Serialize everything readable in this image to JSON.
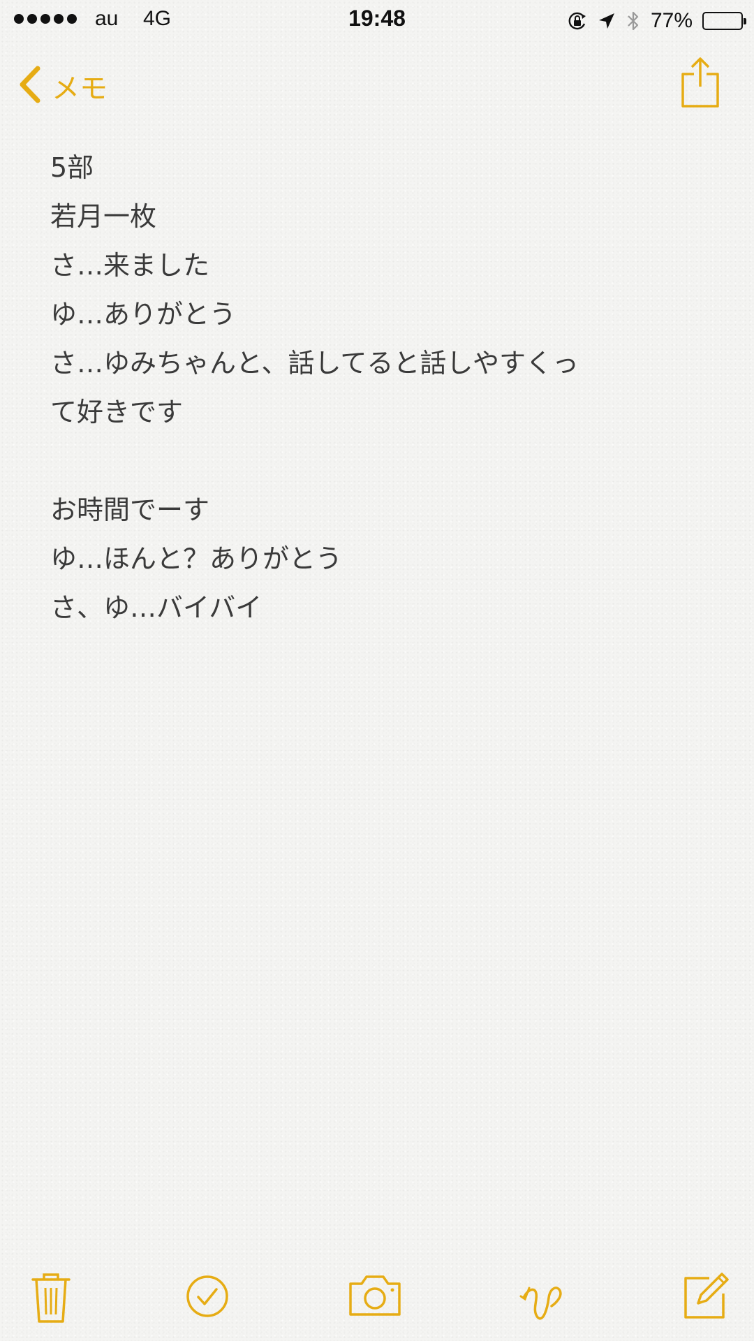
{
  "status_bar": {
    "carrier": "au",
    "network": "4G",
    "time": "19:48",
    "battery_percent": "77%",
    "battery_level": 0.77,
    "signal_bars": 5,
    "icons": [
      "orientation-lock-icon",
      "location-arrow-icon",
      "bluetooth-icon",
      "battery-icon"
    ]
  },
  "nav": {
    "back_label": "メモ",
    "back_icon": "chevron-left-icon",
    "share_icon": "share-icon"
  },
  "note": {
    "lines": [
      "5部",
      "若月一枚",
      "さ…来ました",
      "ゆ…ありがとう",
      "さ…ゆみちゃんと、話してると話しやすくっ",
      "て好きです",
      "",
      "お時間でーす",
      "ゆ…ほんと？ありがとう",
      "さ、ゆ…バイバイ"
    ]
  },
  "toolbar": {
    "items": [
      "trash-icon",
      "checklist-icon",
      "camera-icon",
      "sketch-icon",
      "compose-icon"
    ]
  },
  "colors": {
    "accent": "#e6ac14",
    "text": "#333333",
    "background": "#f4f4f2"
  }
}
